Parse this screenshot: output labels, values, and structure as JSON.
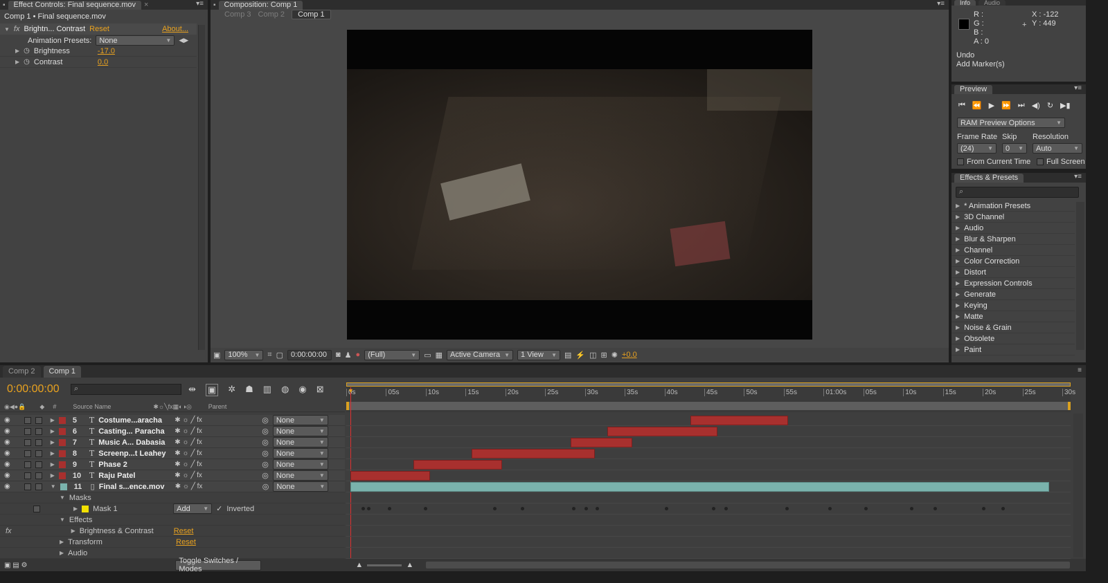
{
  "effect_controls": {
    "tab_label": "Effect Controls: Final sequence.mov",
    "breadcrumb": "Comp 1 • Final sequence.mov",
    "effect_name": "Brightn... Contrast",
    "reset": "Reset",
    "about": "About...",
    "presets_label": "Animation Presets:",
    "presets_value": "None",
    "params": [
      {
        "name": "Brightness",
        "value": "-17.0"
      },
      {
        "name": "Contrast",
        "value": "0.0"
      }
    ]
  },
  "composition": {
    "tab_label": "Composition: Comp 1",
    "crumbs": [
      "Comp 3",
      "Comp 2",
      "Comp 1"
    ],
    "zoom": "100%",
    "timecode": "0:00:00:00",
    "resolution": "(Full)",
    "camera": "Active Camera",
    "views": "1 View",
    "exposure": "+0.0"
  },
  "info": {
    "tab": "Info",
    "tab2": "Audio",
    "r": "R :",
    "g": "G :",
    "b": "B :",
    "a": "A : 0",
    "x": "X : -122",
    "y": "Y : 449",
    "undo": "Undo",
    "last_action": "Add Marker(s)"
  },
  "preview": {
    "tab": "Preview",
    "ram_options": "RAM Preview Options",
    "frame_rate_label": "Frame Rate",
    "skip_label": "Skip",
    "resolution_label": "Resolution",
    "frame_rate": "(24)",
    "skip": "0",
    "resolution": "Auto",
    "from_current": "From Current Time",
    "full_screen": "Full Screen"
  },
  "effects_presets": {
    "tab": "Effects & Presets",
    "items": [
      "* Animation Presets",
      "3D Channel",
      "Audio",
      "Blur & Sharpen",
      "Channel",
      "Color Correction",
      "Distort",
      "Expression Controls",
      "Generate",
      "Keying",
      "Matte",
      "Noise & Grain",
      "Obsolete",
      "Paint"
    ]
  },
  "timeline": {
    "tabs": [
      "Comp 2",
      "Comp 1"
    ],
    "timecode": "0:00:00:00",
    "col_num": "#",
    "col_source": "Source Name",
    "col_parent": "Parent",
    "ruler": [
      "0s",
      "05s",
      "10s",
      "15s",
      "20s",
      "25s",
      "30s",
      "35s",
      "40s",
      "45s",
      "50s",
      "55s",
      "01:00s",
      "05s",
      "10s",
      "15s",
      "20s",
      "25s",
      "30s"
    ],
    "layers": [
      {
        "num": "5",
        "name": "Costume...aracha",
        "parent": "None",
        "bar_start": 0.475,
        "bar_end": 0.61
      },
      {
        "num": "6",
        "name": "Casting... Paracha",
        "parent": "None",
        "bar_start": 0.36,
        "bar_end": 0.512
      },
      {
        "num": "7",
        "name": "Music A... Dabasia",
        "parent": "None",
        "bar_start": 0.31,
        "bar_end": 0.395
      },
      {
        "num": "8",
        "name": "Screenp...t Leahey",
        "parent": "None",
        "bar_start": 0.173,
        "bar_end": 0.343
      },
      {
        "num": "9",
        "name": "Phase 2",
        "parent": "None",
        "bar_start": 0.093,
        "bar_end": 0.215
      },
      {
        "num": "10",
        "name": "Raju Patel",
        "parent": "None",
        "bar_start": 0.006,
        "bar_end": 0.116
      },
      {
        "num": "11",
        "name": "Final s...ence.mov",
        "parent": "None",
        "bar_start": 0.006,
        "bar_end": 0.97
      }
    ],
    "masks_label": "Masks",
    "mask_name": "Mask 1",
    "mask_mode": "Add",
    "inverted": "Inverted",
    "effects_label": "Effects",
    "effect_name": "Brightness & Contrast",
    "effect_reset": "Reset",
    "transform_label": "Transform",
    "transform_reset": "Reset",
    "audio_label": "Audio",
    "toggle": "Toggle Switches / Modes"
  },
  "colors": {
    "accent": "#e9a21f",
    "layer_red": "#a8302e",
    "video_teal": "#7ab3ad"
  }
}
